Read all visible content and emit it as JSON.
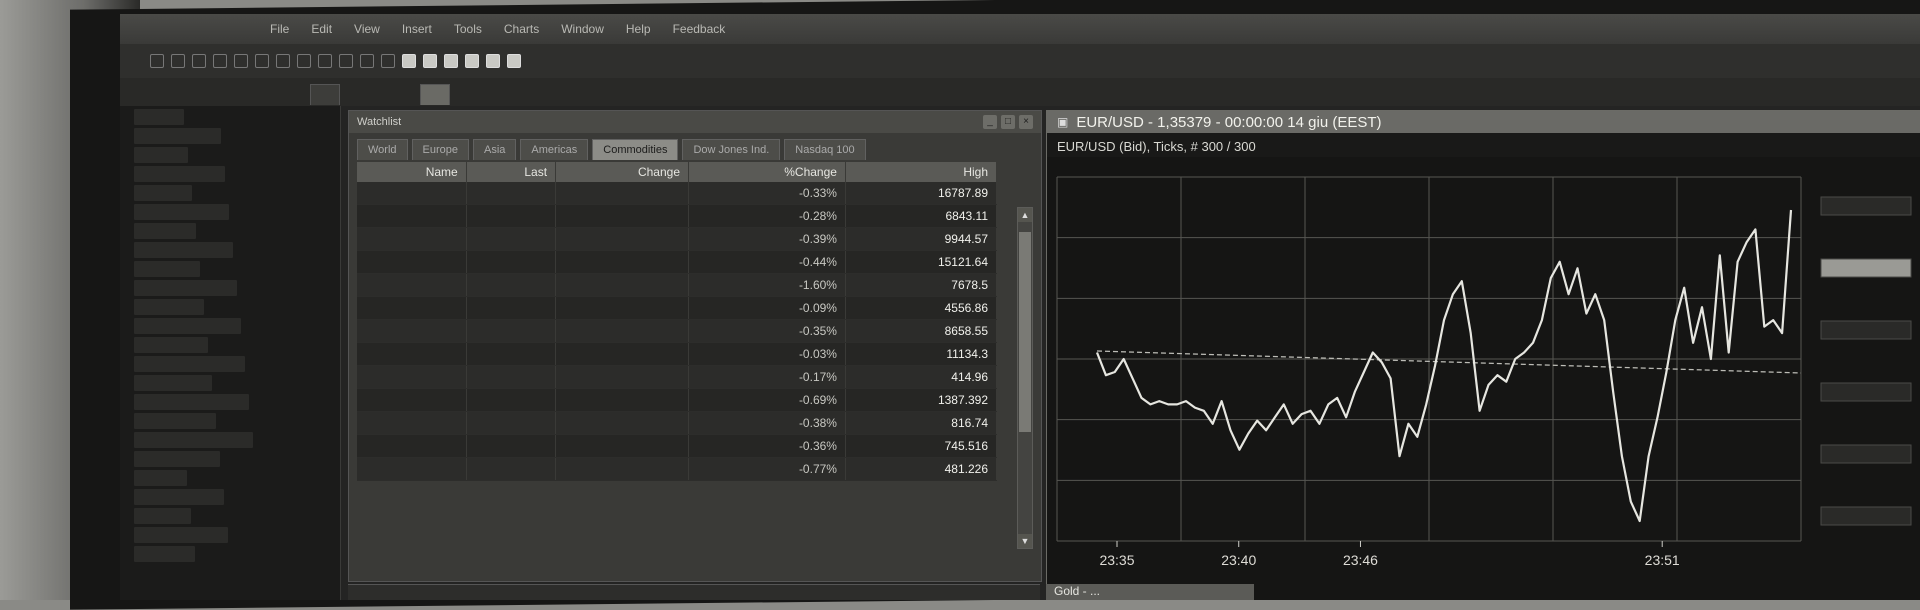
{
  "menubar": {
    "items": [
      "File",
      "Edit",
      "View",
      "Insert",
      "Tools",
      "Charts",
      "Window",
      "Help",
      "Feedback"
    ]
  },
  "toolbar": {
    "buttons": [
      "cursor-icon",
      "line-icon",
      "hline-icon",
      "trend-icon",
      "text-icon",
      "zoom-in-icon",
      "zoom-out-icon",
      "grid-icon",
      "chart-bar-icon",
      "chart-candle-icon",
      "chart-line-icon",
      "settings-icon"
    ]
  },
  "watchlist": {
    "title": "Watchlist",
    "tabs": [
      "World",
      "Europe",
      "Asia",
      "Americas",
      "Commodities",
      "Dow Jones Ind.",
      "Nasdaq 100"
    ],
    "active_tab": 4,
    "columns": [
      "Name",
      "Last",
      "Change",
      "%Change",
      "High"
    ],
    "rows": [
      {
        "name": "",
        "last": "",
        "change": "",
        "pct": "-0.33%",
        "high": "16787.89"
      },
      {
        "name": "",
        "last": "",
        "change": "",
        "pct": "-0.28%",
        "high": "6843.11"
      },
      {
        "name": "",
        "last": "",
        "change": "",
        "pct": "-0.39%",
        "high": "9944.57"
      },
      {
        "name": "",
        "last": "",
        "change": "",
        "pct": "-0.44%",
        "high": "15121.64"
      },
      {
        "name": "",
        "last": "",
        "change": "",
        "pct": "-1.60%",
        "high": "7678.5"
      },
      {
        "name": "",
        "last": "",
        "change": "",
        "pct": "-0.09%",
        "high": "4556.86"
      },
      {
        "name": "",
        "last": "",
        "change": "",
        "pct": "-0.35%",
        "high": "8658.55"
      },
      {
        "name": "",
        "last": "",
        "change": "",
        "pct": "-0.03%",
        "high": "11134.3"
      },
      {
        "name": "",
        "last": "",
        "change": "",
        "pct": "-0.17%",
        "high": "414.96"
      },
      {
        "name": "",
        "last": "",
        "change": "",
        "pct": "-0.69%",
        "high": "1387.392"
      },
      {
        "name": "",
        "last": "",
        "change": "",
        "pct": "-0.38%",
        "high": "816.74"
      },
      {
        "name": "",
        "last": "",
        "change": "",
        "pct": "-0.36%",
        "high": "745.516"
      },
      {
        "name": "",
        "last": "",
        "change": "",
        "pct": "-0.77%",
        "high": "481.226"
      }
    ]
  },
  "chart_window": {
    "title": "EUR/USD - 1,35379 - 00:00:00  14 giu (EEST)",
    "subtitle": "EUR/USD (Bid), Ticks, # 300 / 300"
  },
  "chart_data": {
    "type": "line",
    "title": "EUR/USD (Bid), Ticks, # 300 / 300",
    "xlabel": "",
    "ylabel": "",
    "x_ticks": [
      "23:35",
      "23:40",
      "23:46",
      "23:51"
    ],
    "grid": true,
    "reference_line": "dashed",
    "series": [
      {
        "name": "EUR/USD (Bid)",
        "values": [
          0.52,
          0.45,
          0.46,
          0.5,
          0.44,
          0.38,
          0.36,
          0.37,
          0.36,
          0.36,
          0.37,
          0.35,
          0.34,
          0.3,
          0.37,
          0.28,
          0.22,
          0.27,
          0.31,
          0.28,
          0.32,
          0.36,
          0.3,
          0.33,
          0.34,
          0.3,
          0.36,
          0.38,
          0.32,
          0.4,
          0.46,
          0.52,
          0.49,
          0.44,
          0.2,
          0.3,
          0.26,
          0.36,
          0.48,
          0.62,
          0.7,
          0.74,
          0.58,
          0.34,
          0.42,
          0.45,
          0.43,
          0.5,
          0.52,
          0.55,
          0.62,
          0.75,
          0.8,
          0.7,
          0.78,
          0.64,
          0.7,
          0.62,
          0.4,
          0.2,
          0.06,
          0.0,
          0.2,
          0.32,
          0.46,
          0.62,
          0.72,
          0.55,
          0.66,
          0.5,
          0.82,
          0.52,
          0.8,
          0.86,
          0.9,
          0.6,
          0.62,
          0.58,
          0.96
        ]
      }
    ],
    "reference_value": 0.5
  },
  "bottom_tab": {
    "label": "Gold - ..."
  }
}
